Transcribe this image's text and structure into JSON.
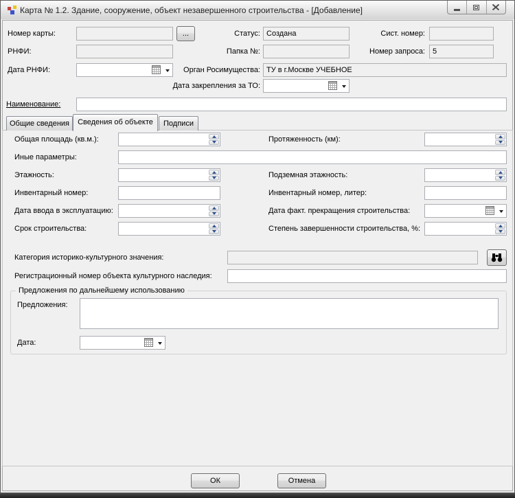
{
  "window": {
    "title": "Карта № 1.2. Здание, сооружение, объект незавершенного строительства - [Добавление]"
  },
  "header": {
    "card_number_label": "Номер карты:",
    "card_number_value": "",
    "browse_button_label": "...",
    "status_label": "Статус:",
    "status_value": "Создана",
    "sys_number_label": "Сист. номер:",
    "sys_number_value": "",
    "rnfi_label": "РНФИ:",
    "rnfi_value": "",
    "folder_label": "Папка №:",
    "folder_value": "",
    "request_number_label": "Номер запроса:",
    "request_number_value": "5",
    "rnfi_date_label": "Дата РНФИ:",
    "rnfi_date_value": "",
    "organ_label": "Орган Росимущества:",
    "organ_value": "ТУ в г.Москве УЧЕБНОЕ",
    "to_date_label": "Дата закрепления за ТО:",
    "to_date_value": "",
    "name_label": "Наименование:",
    "name_value": ""
  },
  "tabs": {
    "general": "Общие сведения",
    "object": "Сведения об объекте",
    "signatures": "Подписи"
  },
  "object_tab": {
    "total_area_label": "Общая площадь (кв.м.):",
    "total_area_value": "",
    "extent_label": "Протяженность (км):",
    "extent_value": "",
    "other_params_label": "Иные параметры:",
    "other_params_value": "",
    "floors_label": "Этажность:",
    "floors_value": "",
    "underground_floors_label": "Подземная этажность:",
    "underground_floors_value": "",
    "inventory_number_label": "Инвентарный номер:",
    "inventory_number_value": "",
    "inventory_liter_label": "Инвентарный номер, литер:",
    "inventory_liter_value": "",
    "commissioning_date_label": "Дата ввода в эксплуатацию:",
    "commissioning_date_value": "",
    "construction_end_date_label": "Дата факт. прекращения строительства:",
    "construction_end_date_value": "",
    "construction_term_label": "Срок строительства:",
    "construction_term_value": "",
    "completion_percent_label": "Степень завершенности строительства, %:",
    "completion_percent_value": "",
    "heritage_category_label": "Категория историко-культурного значения:",
    "heritage_category_value": "",
    "heritage_reg_number_label": "Регистрационный номер объекта культурного наследия:",
    "heritage_reg_number_value": ""
  },
  "proposals_group": {
    "title": "Предложения по дальнейшему использованию",
    "proposals_label": "Предложения:",
    "proposals_value": "",
    "date_label": "Дата:",
    "date_value": ""
  },
  "footer": {
    "ok_label": "ОК",
    "cancel_label": "Отмена"
  },
  "colors": {
    "spinner_arrow": "#31538F",
    "form_background": "#F0F0F0",
    "disabled_field": "#F0F0F0"
  }
}
